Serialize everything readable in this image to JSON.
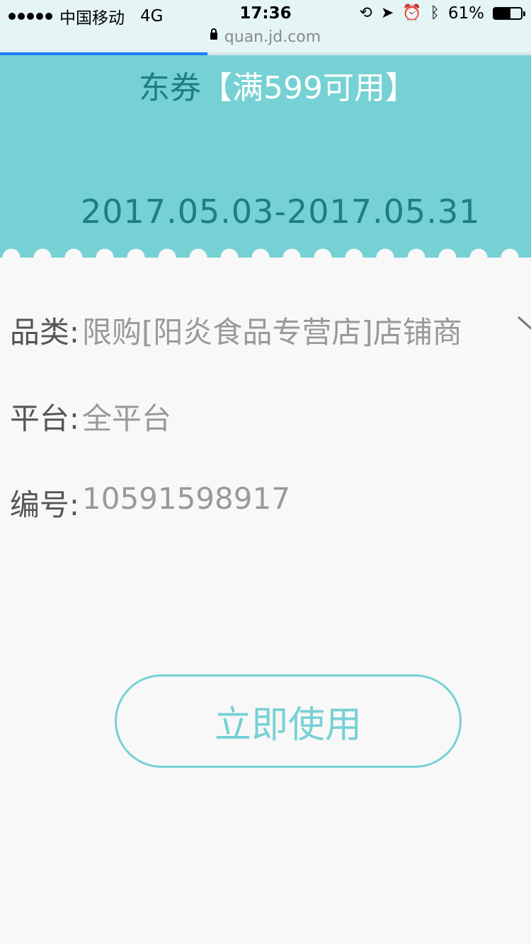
{
  "status_bar": {
    "carrier": "中国移动",
    "network": "4G",
    "time": "17:36",
    "battery_text": "61%",
    "battery_level": 0.61
  },
  "browser": {
    "url": "quan.jd.com",
    "load_progress": 0.39
  },
  "coupon": {
    "title_brand": "东券",
    "title_condition": "【满599可用】",
    "validity": "2017.05.03-2017.05.31"
  },
  "details": {
    "category_label": "品类:",
    "category_value": "限购[阳炎食品专营店]店铺商",
    "platform_label": "平台:",
    "platform_value": "全平台",
    "number_label": "编号:",
    "number_value": "10591598917"
  },
  "actions": {
    "use_now_label": "立即使用"
  },
  "colors": {
    "accent": "#76d1d4",
    "accent_dark": "#1c7f80",
    "progress": "#1c7cff",
    "background": "#f8f8f8"
  }
}
